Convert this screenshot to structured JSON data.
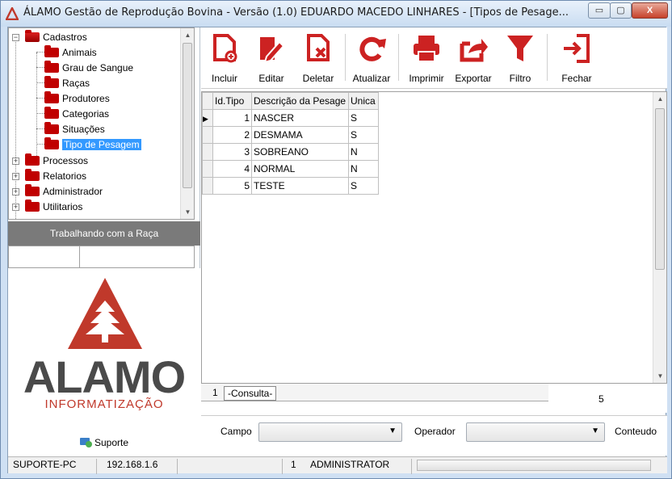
{
  "window": {
    "title": "ÁLAMO Gestão de Reprodução Bovina - Versão (1.0) EDUARDO MACEDO LINHARES - [Tipos de Pesage...",
    "buttons": {
      "minimize": "▭",
      "maximize": "▢",
      "close": "X"
    }
  },
  "tree": {
    "root_open": "Cadastros",
    "children": [
      "Animais",
      "Grau de Sangue",
      "Raças",
      "Produtores",
      "Categorias",
      "Situações",
      "Tipo de Pesagem"
    ],
    "selected": "Tipo de Pesagem",
    "collapsed": [
      "Processos",
      "Relatorios",
      "Administrador",
      "Utilitarios"
    ]
  },
  "left_panel": {
    "raca_header": "Trabalhando com a Raça",
    "raca_code": "",
    "raca_name": "",
    "logo_word": "ALAMO",
    "logo_sub": "INFORMATIZAÇÃO",
    "support_label": "Suporte"
  },
  "toolbar": {
    "incluir": "Incluir",
    "editar": "Editar",
    "deletar": "Deletar",
    "atualizar": "Atualizar",
    "imprimir": "Imprimir",
    "exportar": "Exportar",
    "filtro": "Filtro",
    "fechar": "Fechar"
  },
  "grid": {
    "columns": [
      "Id.Tipo",
      "Descrição da Pesage",
      "Unica"
    ],
    "rows": [
      {
        "id": "1",
        "descricao": "NASCER",
        "unica": "S"
      },
      {
        "id": "2",
        "descricao": "DESMAMA",
        "unica": "S"
      },
      {
        "id": "3",
        "descricao": "SOBREANO",
        "unica": "N"
      },
      {
        "id": "4",
        "descricao": "NORMAL",
        "unica": "N"
      },
      {
        "id": "5",
        "descricao": "TESTE",
        "unica": "S"
      }
    ]
  },
  "tabs": {
    "page": "1",
    "consulta": "-Consulta-",
    "record_count": "5"
  },
  "filter": {
    "campo_label": "Campo",
    "campo_value": "",
    "operador_label": "Operador",
    "operador_value": "",
    "conteudo_label": "Conteudo"
  },
  "status": {
    "computer": "SUPORTE-PC",
    "ip": "192.168.1.6",
    "user_id": "1",
    "user": "ADMINISTRATOR"
  },
  "colors": {
    "brand_red": "#c0392b",
    "selection": "#3399ff"
  }
}
